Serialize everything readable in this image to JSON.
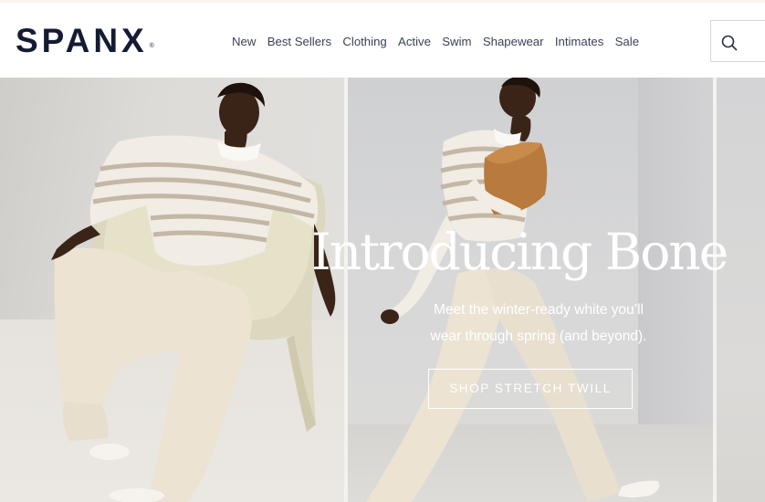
{
  "brand": {
    "logo_text": "SPANX",
    "logo_mark": "®"
  },
  "nav": {
    "items": [
      {
        "label": "New"
      },
      {
        "label": "Best Sellers"
      },
      {
        "label": "Clothing"
      },
      {
        "label": "Active"
      },
      {
        "label": "Swim"
      },
      {
        "label": "Shapewear"
      },
      {
        "label": "Intimates"
      },
      {
        "label": "Sale"
      }
    ]
  },
  "search": {
    "icon": "search-icon"
  },
  "hero": {
    "headline": "Introducing Bone",
    "subtext_line1": "Meet the winter-ready white you’ll",
    "subtext_line2": "wear through spring (and beyond).",
    "cta_label": "SHOP STRETCH TWILL"
  },
  "colors": {
    "brand_navy": "#141b33",
    "nav_text": "#3a4256",
    "hero_text": "#ffffff"
  }
}
